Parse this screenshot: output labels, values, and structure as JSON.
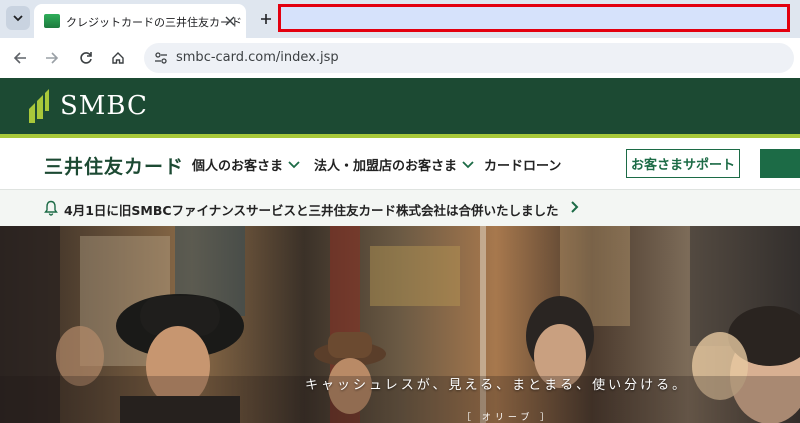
{
  "browser": {
    "tab_title": "クレジットカードの三井住友カード",
    "new_tab_label": "+",
    "url": "smbc-card.com/index.jsp"
  },
  "site": {
    "logo_text": "SMBC",
    "company_name": "三井住友カード",
    "menu": [
      {
        "label": "個人のお客さま"
      },
      {
        "label": "法人・加盟店のお客さま"
      },
      {
        "label": "カードローン"
      }
    ],
    "support_button": "お客さまサポート",
    "notice": "4月1日に旧SMBCファイナンスサービスと三井住友カード株式会社は合併いたしました"
  },
  "hero": {
    "caption": "キャッシュレスが、見える、まとまる、使い分ける。",
    "sub": "［ オリーブ ］"
  },
  "colors": {
    "brand_green": "#1c4a33",
    "lime": "#a8c83a",
    "button_green": "#1c6b46",
    "highlight_border": "#e3000f"
  }
}
